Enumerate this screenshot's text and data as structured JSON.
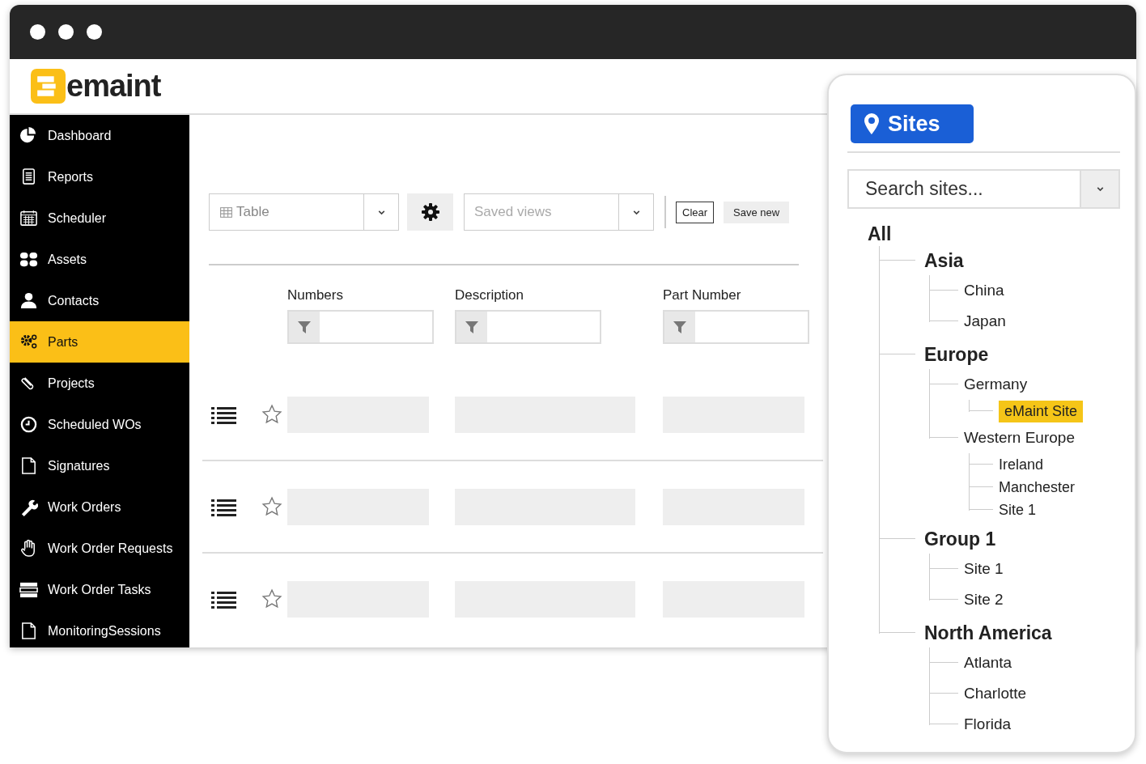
{
  "window": {
    "logo": "emaint"
  },
  "sidebar": {
    "items": [
      {
        "label": "Dashboard",
        "selected": false
      },
      {
        "label": "Reports",
        "selected": false
      },
      {
        "label": "Scheduler",
        "selected": false
      },
      {
        "label": "Assets",
        "selected": false
      },
      {
        "label": "Contacts",
        "selected": false
      },
      {
        "label": "Parts",
        "selected": true
      },
      {
        "label": "Projects",
        "selected": false
      },
      {
        "label": "Scheduled WOs",
        "selected": false
      },
      {
        "label": "Signatures",
        "selected": false
      },
      {
        "label": "Work Orders",
        "selected": false
      },
      {
        "label": "Work Order Requests",
        "selected": false
      },
      {
        "label": "Work Order Tasks",
        "selected": false
      },
      {
        "label": "MonitoringSessions",
        "selected": false
      }
    ]
  },
  "toolbar": {
    "view_select": {
      "value": "Table"
    },
    "saved_views": {
      "placeholder": "Saved views"
    },
    "buttons": [
      {
        "label": "Clear",
        "kind": "outline"
      },
      {
        "label": "Save new",
        "kind": "filled"
      }
    ]
  },
  "columns": [
    {
      "label": "Numbers"
    },
    {
      "label": "Description"
    },
    {
      "label": "Part Number"
    }
  ],
  "rows": [
    {
      "starred": false
    },
    {
      "starred": false
    },
    {
      "starred": false
    }
  ],
  "sites_panel": {
    "button": "Sites",
    "search": {
      "placeholder": "Search sites..."
    },
    "tree": [
      {
        "label": "All",
        "selected": false,
        "children": [
          {
            "label": "Asia",
            "selected": false,
            "children": [
              {
                "label": "China",
                "selected": false
              },
              {
                "label": "Japan",
                "selected": false
              }
            ]
          },
          {
            "label": "Europe",
            "selected": false,
            "children": [
              {
                "label": "Germany",
                "selected": false,
                "children": [
                  {
                    "label": "eMaint Site",
                    "selected": true
                  }
                ]
              },
              {
                "label": "Western Europe",
                "selected": false,
                "children": [
                  {
                    "label": "Ireland",
                    "selected": false
                  },
                  {
                    "label": "Manchester",
                    "selected": false
                  },
                  {
                    "label": "Site 1",
                    "selected": false
                  }
                ]
              }
            ]
          },
          {
            "label": "Group 1",
            "selected": false,
            "children": [
              {
                "label": "Site 1",
                "selected": false
              },
              {
                "label": "Site 2",
                "selected": false
              }
            ]
          },
          {
            "label": "North America",
            "selected": false,
            "children": [
              {
                "label": "Atlanta",
                "selected": false
              },
              {
                "label": "Charlotte",
                "selected": false
              },
              {
                "label": "Florida",
                "selected": false
              }
            ]
          }
        ]
      }
    ]
  }
}
